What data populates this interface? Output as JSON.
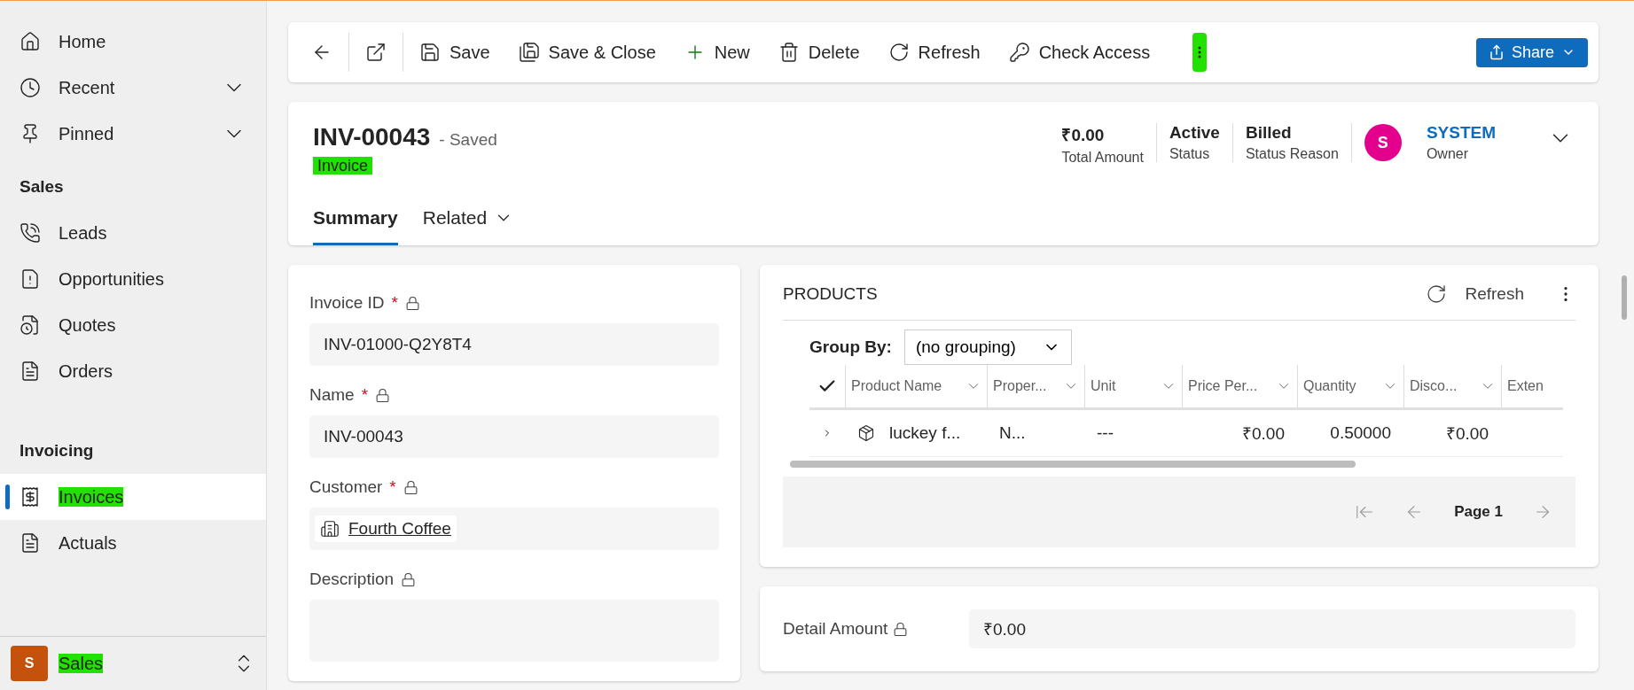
{
  "sidebar": {
    "top_items": [
      {
        "label": "Home",
        "expandable": false
      },
      {
        "label": "Recent",
        "expandable": true
      },
      {
        "label": "Pinned",
        "expandable": true
      }
    ],
    "groups": [
      {
        "title": "Sales",
        "items": [
          {
            "label": "Leads",
            "selected": false,
            "highlighted": false
          },
          {
            "label": "Opportunities",
            "selected": false,
            "highlighted": false
          },
          {
            "label": "Quotes",
            "selected": false,
            "highlighted": false
          },
          {
            "label": "Orders",
            "selected": false,
            "highlighted": false
          }
        ]
      },
      {
        "title": "Invoicing",
        "items": [
          {
            "label": "Invoices",
            "selected": true,
            "highlighted": true
          },
          {
            "label": "Actuals",
            "selected": false,
            "highlighted": false
          }
        ]
      }
    ],
    "area_switcher": {
      "initial": "S",
      "label": "Sales",
      "highlighted": true
    }
  },
  "toolbar": {
    "buttons": [
      {
        "label": "Save"
      },
      {
        "label": "Save & Close"
      },
      {
        "label": "New"
      },
      {
        "label": "Delete"
      },
      {
        "label": "Refresh"
      },
      {
        "label": "Check Access"
      }
    ],
    "overflow_highlighted": true,
    "share": "Share"
  },
  "header": {
    "title": "INV-00043",
    "save_state": "- Saved",
    "entity": "Invoice",
    "entity_highlighted": true,
    "fields": [
      {
        "value": "₹0.00",
        "label": "Total Amount"
      },
      {
        "value": "Active",
        "label": "Status"
      },
      {
        "value": "Billed",
        "label": "Status Reason"
      }
    ],
    "owner": {
      "initial": "S",
      "name": "SYSTEM",
      "label": "Owner"
    },
    "tabs": [
      {
        "label": "Summary",
        "selected": true,
        "dropdown": false
      },
      {
        "label": "Related",
        "selected": false,
        "dropdown": true
      }
    ]
  },
  "form": {
    "fields": [
      {
        "label": "Invoice ID",
        "required_mark": "*",
        "kind": "text",
        "value": "INV-01000-Q2Y8T4"
      },
      {
        "label": "Name",
        "required_mark": "*",
        "kind": "text",
        "value": "INV-00043"
      },
      {
        "label": "Customer",
        "required_mark": "*",
        "kind": "lookup",
        "value": "Fourth Coffee"
      },
      {
        "label": "Description",
        "kind": "textarea"
      }
    ]
  },
  "products": {
    "title": "PRODUCTS",
    "refresh": "Refresh",
    "group_by_label": "Group By:",
    "group_by_value": "(no grouping)",
    "columns": [
      "Product Name",
      "Proper...",
      "Unit",
      "Price Per...",
      "Quantity",
      "Disco...",
      "Exten"
    ],
    "rows": [
      {
        "cells": [
          "luckey f...",
          "N...",
          "---",
          "₹0.00",
          "0.50000",
          "₹0.00"
        ]
      }
    ],
    "page": "Page 1"
  },
  "detail": {
    "label": "Detail Amount",
    "value": "₹0.00"
  }
}
